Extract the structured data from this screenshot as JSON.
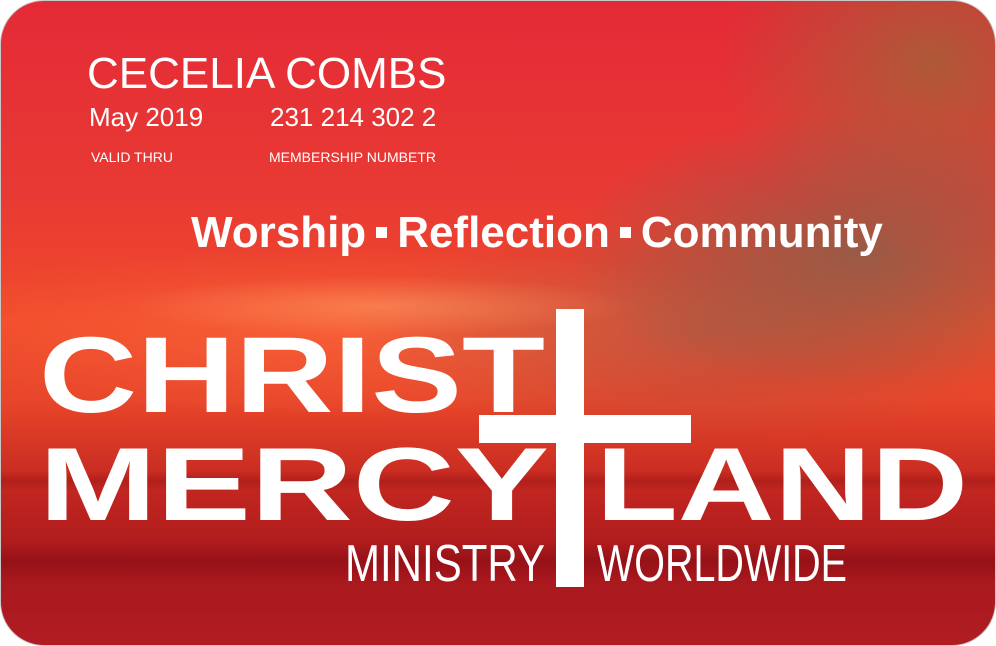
{
  "member": {
    "name": "CECELIA COMBS",
    "valid_thru_value": "May 2019",
    "membership_number": "231 214 302 2",
    "valid_thru_label": "VALID THRU",
    "membership_number_label": "MEMBERSHIP NUMBETR"
  },
  "tagline": {
    "word1": "Worship",
    "word2": "Reflection",
    "word3": "Community"
  },
  "logo": {
    "line1": "CHRIST",
    "line2_left": "MERCY",
    "line2_right": "LAND",
    "line3_left": "MINISTRY",
    "line3_right": "WORLDWIDE"
  },
  "colors": {
    "card_red": "#e83a34",
    "text": "#ffffff"
  }
}
